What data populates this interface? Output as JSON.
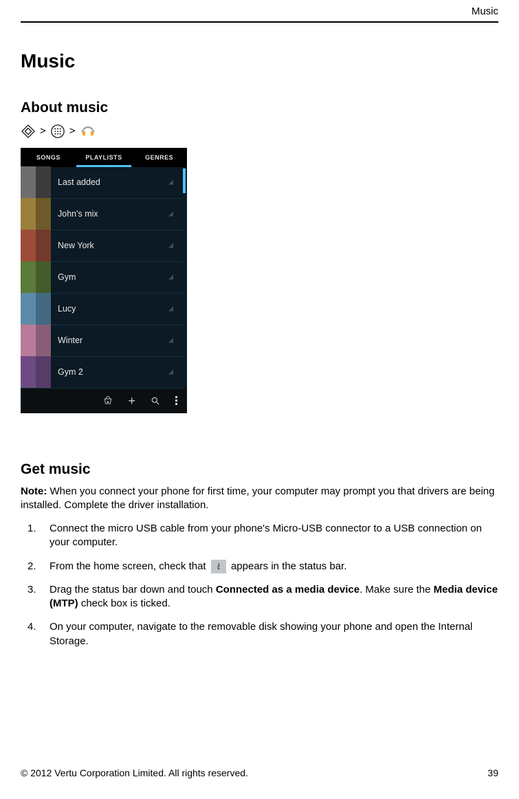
{
  "header": {
    "rightLabel": "Music"
  },
  "title": "Music",
  "aboutSection": {
    "heading": "About music",
    "path": {
      "sep": ">"
    }
  },
  "phone": {
    "tabs": [
      "SONGS",
      "PLAYLISTS",
      "GENRES"
    ],
    "playlists": [
      {
        "name": "Last added",
        "colors": [
          "#6e6e6e",
          "#3b3b3b",
          "#6e6e6e",
          "#3b3b3b"
        ]
      },
      {
        "name": "John's mix",
        "colors": [
          "#9b7f3b",
          "#6d5a28",
          "#9b7f3b",
          "#6d5a28"
        ]
      },
      {
        "name": "New York",
        "colors": [
          "#9e4c3a",
          "#73392c",
          "#9e4c3a",
          "#73392c"
        ]
      },
      {
        "name": "Gym",
        "colors": [
          "#5c7a3a",
          "#445b2a",
          "#5c7a3a",
          "#445b2a"
        ]
      },
      {
        "name": "Lucy",
        "colors": [
          "#5d8aa8",
          "#436a82",
          "#5d8aa8",
          "#436a82"
        ]
      },
      {
        "name": "Winter",
        "colors": [
          "#b97b9a",
          "#8a5d76",
          "#b97b9a",
          "#8a5d76"
        ]
      },
      {
        "name": "Gym 2",
        "colors": [
          "#6e4a82",
          "#573b68",
          "#6e4a82",
          "#573b68"
        ]
      }
    ]
  },
  "getMusic": {
    "heading": "Get music",
    "noteLabel": "Note:",
    "noteBody": " When you connect your phone for first time, your computer may prompt you that drivers are being installed. Complete the driver installation.",
    "steps": {
      "s1": "Connect the micro USB cable from your phone's Micro-USB connector to a USB connection on your computer.",
      "s2a": "From the home screen, check that ",
      "s2b": " appears in the status bar.",
      "s3a": "Drag the status bar down and touch ",
      "s3b": "Connected as a media device",
      "s3c": ". Make sure the ",
      "s3d": "Media device (MTP)",
      "s3e": " check box is ticked.",
      "s4": "On your computer, navigate to the removable disk showing your phone and open the Internal Storage."
    }
  },
  "footer": {
    "copyright": "© 2012 Vertu Corporation Limited. All rights reserved.",
    "pageNumber": "39"
  }
}
